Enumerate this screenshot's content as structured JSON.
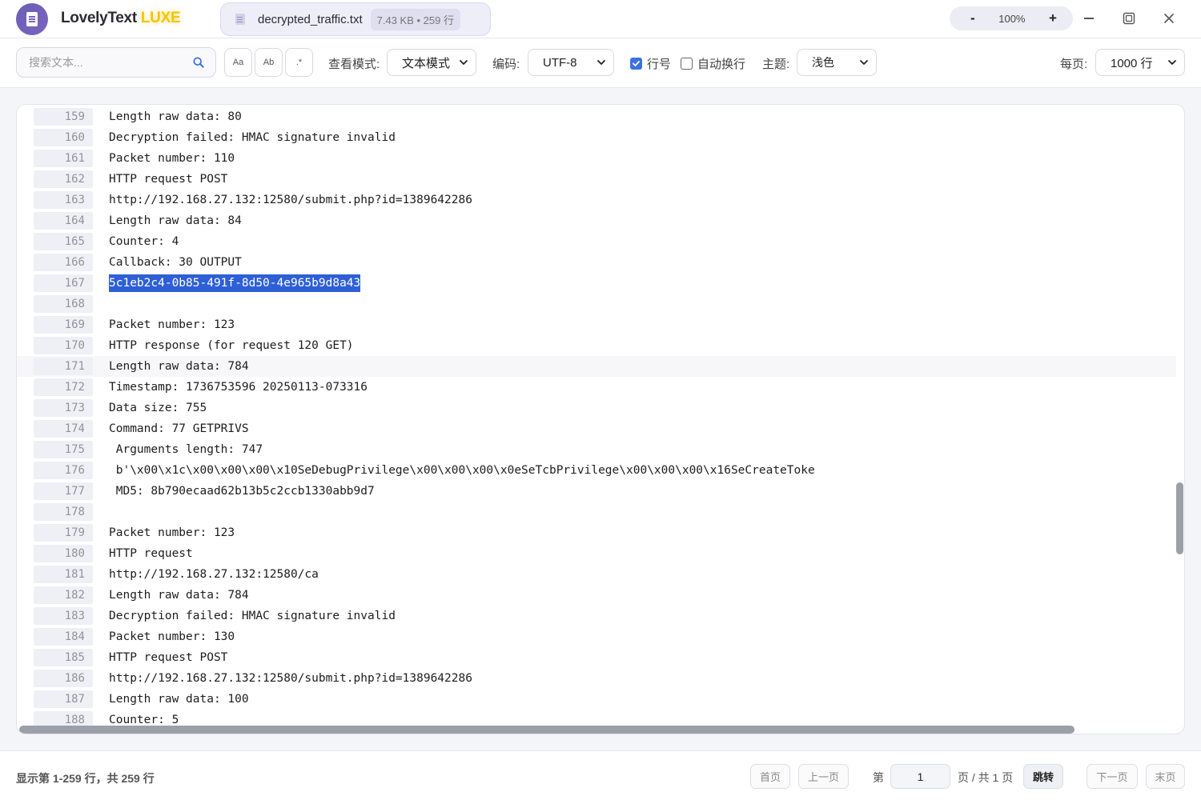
{
  "app": {
    "name": "LovelyText",
    "edition": "LUXE"
  },
  "file_tab": {
    "filename": "decrypted_traffic.txt",
    "meta": "7.43 KB • 259 行"
  },
  "zoom": {
    "minus": "-",
    "value": "100%",
    "plus": "+"
  },
  "toolbar": {
    "search_placeholder": "搜索文本...",
    "match_case": "Aa",
    "whole_word": "Ab",
    "regex": ".*",
    "view_mode_label": "查看模式:",
    "view_mode_value": "文本模式",
    "encoding_label": "编码:",
    "encoding_value": "UTF-8",
    "line_numbers_label": "行号",
    "line_numbers_checked": true,
    "word_wrap_label": "自动换行",
    "word_wrap_checked": false,
    "theme_label": "主题:",
    "theme_value": "浅色",
    "per_page_label": "每页:",
    "per_page_value": "1000 行"
  },
  "editor": {
    "selected_line": 167,
    "hovered_line": 171,
    "lines": [
      {
        "n": "159",
        "t": "Length raw data: 80"
      },
      {
        "n": "160",
        "t": "Decryption failed: HMAC signature invalid"
      },
      {
        "n": "161",
        "t": "Packet number: 110"
      },
      {
        "n": "162",
        "t": "HTTP request POST"
      },
      {
        "n": "163",
        "t": "http://192.168.27.132:12580/submit.php?id=1389642286"
      },
      {
        "n": "164",
        "t": "Length raw data: 84"
      },
      {
        "n": "165",
        "t": "Counter: 4"
      },
      {
        "n": "166",
        "t": "Callback: 30 OUTPUT"
      },
      {
        "n": "167",
        "t": "5c1eb2c4-0b85-491f-8d50-4e965b9d8a43"
      },
      {
        "n": "168",
        "t": ""
      },
      {
        "n": "169",
        "t": "Packet number: 123"
      },
      {
        "n": "170",
        "t": "HTTP response (for request 120 GET)"
      },
      {
        "n": "171",
        "t": "Length raw data: 784"
      },
      {
        "n": "172",
        "t": "Timestamp: 1736753596 20250113-073316"
      },
      {
        "n": "173",
        "t": "Data size: 755"
      },
      {
        "n": "174",
        "t": "Command: 77 GETPRIVS"
      },
      {
        "n": "175",
        "t": " Arguments length: 747"
      },
      {
        "n": "176",
        "t": " b'\\x00\\x1c\\x00\\x00\\x00\\x10SeDebugPrivilege\\x00\\x00\\x00\\x0eSeTcbPrivilege\\x00\\x00\\x00\\x16SeCreateToke"
      },
      {
        "n": "177",
        "t": " MD5: 8b790ecaad62b13b5c2ccb1330abb9d7"
      },
      {
        "n": "178",
        "t": ""
      },
      {
        "n": "179",
        "t": "Packet number: 123"
      },
      {
        "n": "180",
        "t": "HTTP request"
      },
      {
        "n": "181",
        "t": "http://192.168.27.132:12580/ca"
      },
      {
        "n": "182",
        "t": "Length raw data: 784"
      },
      {
        "n": "183",
        "t": "Decryption failed: HMAC signature invalid"
      },
      {
        "n": "184",
        "t": "Packet number: 130"
      },
      {
        "n": "185",
        "t": "HTTP request POST"
      },
      {
        "n": "186",
        "t": "http://192.168.27.132:12580/submit.php?id=1389642286"
      },
      {
        "n": "187",
        "t": "Length raw data: 100"
      },
      {
        "n": "188",
        "t": "Counter: 5"
      }
    ]
  },
  "status": {
    "summary": "显示第 1-259 行，共 259 行",
    "first": "首页",
    "prev": "上一页",
    "page_prefix": "第",
    "page_value": "1",
    "page_suffix": "页 / 共 1 页",
    "jump": "跳转",
    "next": "下一页",
    "last": "末页"
  },
  "colors": {
    "accent": "#3b72e0",
    "selection": "#2e5fd6",
    "brand_gold": "#f7c300",
    "brand_purple": "#7b63c2"
  },
  "icons": [
    "app-doc-icon",
    "file-doc-icon",
    "search-icon",
    "chevron-down-icon",
    "checkmark-icon",
    "minimize-icon",
    "maximize-icon",
    "close-icon"
  ]
}
